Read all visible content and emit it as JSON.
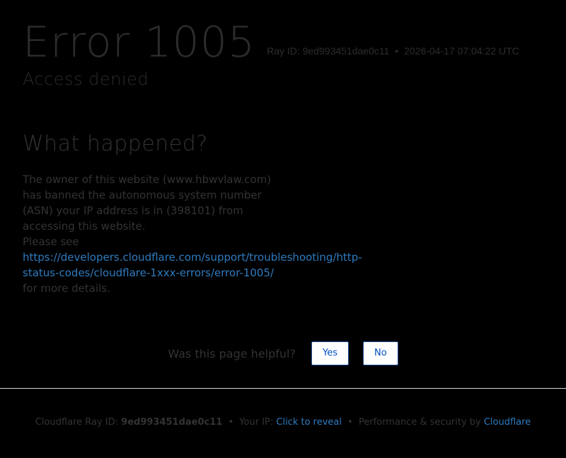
{
  "header": {
    "error_code": "Error 1005",
    "ray_label": "Ray ID: 9ed993451dae0c11",
    "bullet": "•",
    "timestamp": "2026-04-17 07:04:22 UTC",
    "subtitle": "Access denied"
  },
  "main": {
    "heading": "What happened?",
    "description": "The owner of this website (www.hbwvlaw.com) has banned the autonomous system number (ASN) your IP address is in (398101) from accessing this website.",
    "please_see": "Please see",
    "link_text": "https://developers.cloudflare.com/support/troubleshooting/http-status-codes/cloudflare-1xxx-errors/error-1005/",
    "more_details": "for more details."
  },
  "feedback": {
    "question": "Was this page helpful?",
    "yes_label": "Yes",
    "no_label": "No"
  },
  "footer": {
    "ray_label": "Cloudflare Ray ID:",
    "ray_id": "9ed993451dae0c11",
    "bullet": "•",
    "ip_label": "Your IP:",
    "ip_link": "Click to reveal",
    "perf_label": "Performance & security by",
    "brand_link": "Cloudflare"
  },
  "colors": {
    "background": "#000000",
    "text_dim": "#333333",
    "link": "#2f7bbf",
    "button_border": "#1d4f99"
  }
}
